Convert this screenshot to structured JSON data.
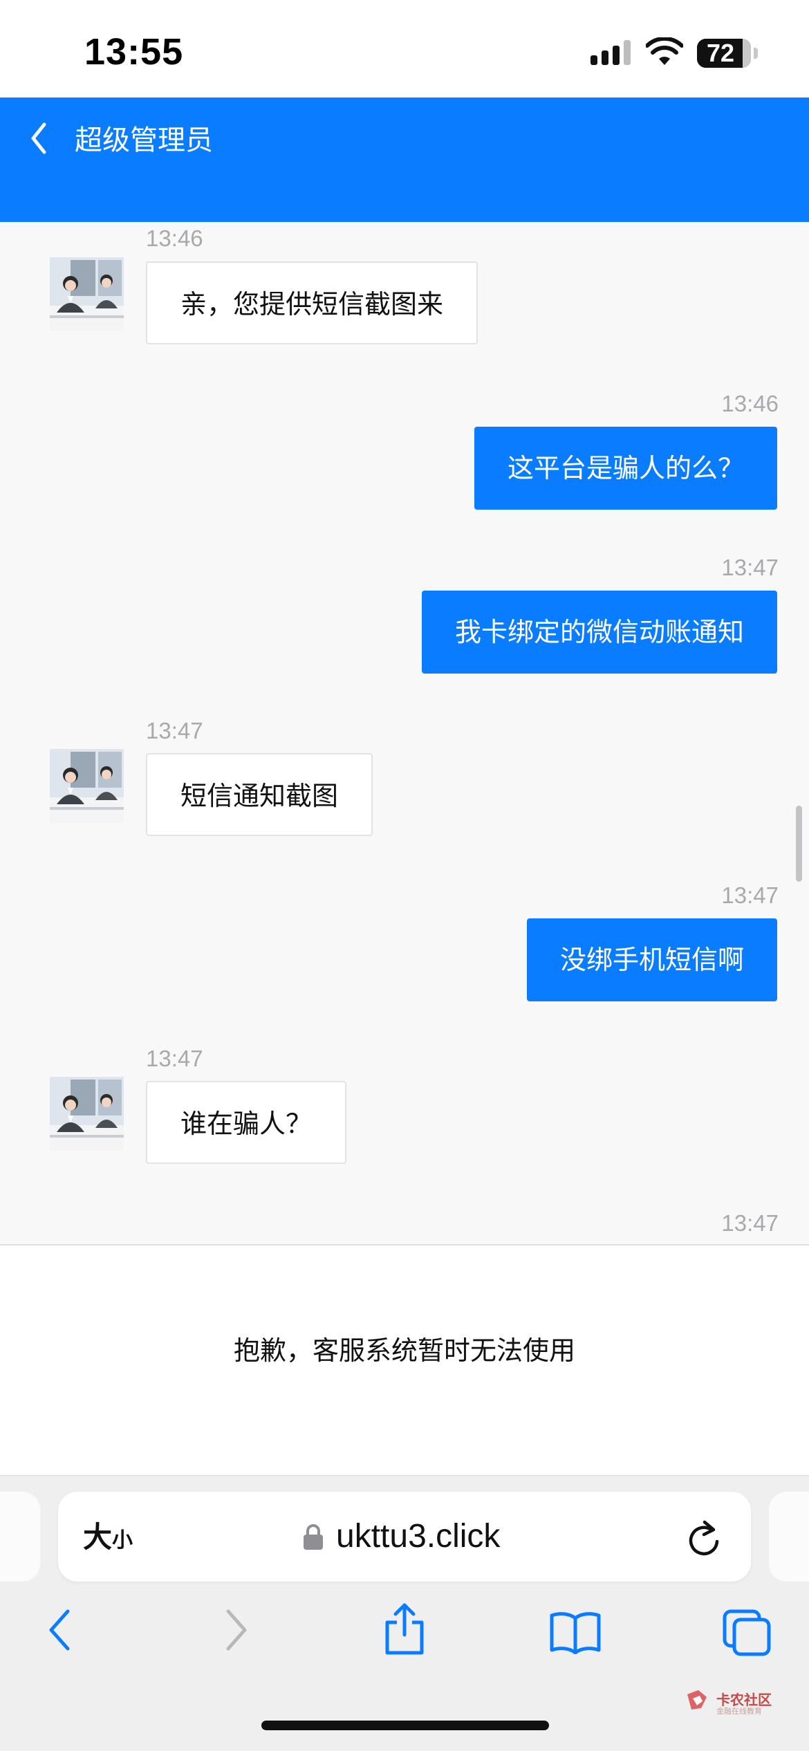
{
  "status_bar": {
    "time": "13:55",
    "battery": "72"
  },
  "header": {
    "title": "超级管理员"
  },
  "messages": [
    {
      "time": "13:46",
      "side": "in",
      "text": "亲，您提供短信截图来"
    },
    {
      "time": "13:46",
      "side": "out",
      "text": "这平台是骗人的么？"
    },
    {
      "time": "13:47",
      "side": "out",
      "text": "我卡绑定的微信动账通知"
    },
    {
      "time": "13:47",
      "side": "in",
      "text": "短信通知截图"
    },
    {
      "time": "13:47",
      "side": "out",
      "text": "没绑手机短信啊"
    },
    {
      "time": "13:47",
      "side": "in",
      "text": "谁在骗人？"
    },
    {
      "time": "13:47",
      "side": "out",
      "text": ""
    }
  ],
  "notice": "抱歉，客服系统暂时无法使用",
  "browser": {
    "text_size_big": "大",
    "text_size_small": "小",
    "url": "ukttu3.click"
  },
  "watermark": {
    "main": "卡农社区",
    "sub": "金融在线教育"
  },
  "colors": {
    "accent": "#0a7cff",
    "bubble_in": "#ffffff",
    "timestamp": "#a9a9ad"
  }
}
